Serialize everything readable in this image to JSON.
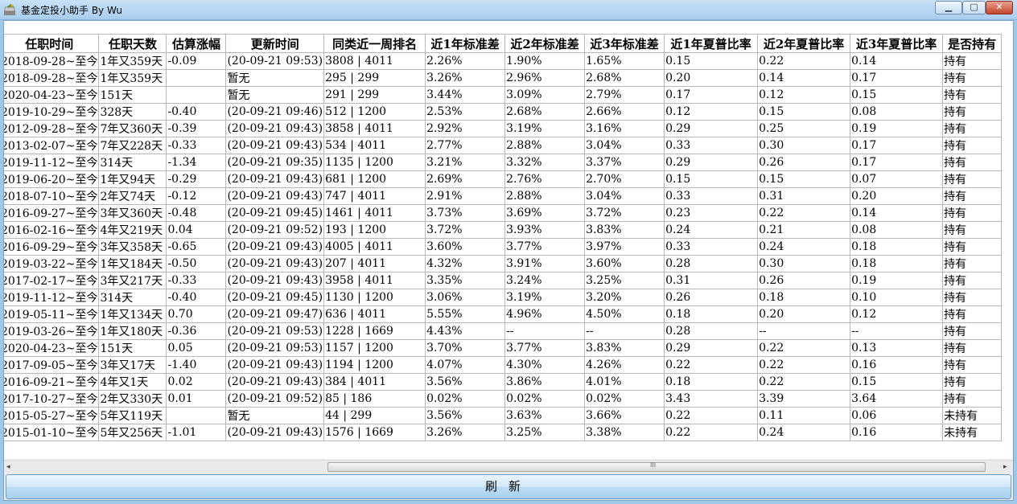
{
  "window": {
    "title": "基金定投小助手 By Wu",
    "min": "▁",
    "max": "▢",
    "close": "✕"
  },
  "table": {
    "columns": [
      "任职时间",
      "任职天数",
      "估算涨幅",
      "更新时间",
      "同类近一周排名",
      "近1年标准差",
      "近2年标准差",
      "近3年标准差",
      "近1年夏普比率",
      "近2年夏普比率",
      "近3年夏普比率",
      "是否持有"
    ],
    "rows": [
      [
        "2018-09-28~至今",
        "1年又359天",
        "-0.09",
        "(20-09-21 09:53)",
        "3808 | 4011",
        "2.26%",
        "1.90%",
        "1.65%",
        "0.15",
        "0.22",
        "0.14",
        "持有"
      ],
      [
        "2018-09-28~至今",
        "1年又359天",
        "",
        "暂无",
        "295 | 299",
        "3.26%",
        "2.96%",
        "2.68%",
        "0.20",
        "0.14",
        "0.17",
        "持有"
      ],
      [
        "2020-04-23~至今",
        "151天",
        "",
        "暂无",
        "291 | 299",
        "3.44%",
        "3.09%",
        "2.79%",
        "0.17",
        "0.12",
        "0.15",
        "持有"
      ],
      [
        "2019-10-29~至今",
        "328天",
        "-0.40",
        "(20-09-21 09:46)",
        "512 | 1200",
        "2.53%",
        "2.68%",
        "2.66%",
        "0.12",
        "0.15",
        "0.08",
        "持有"
      ],
      [
        "2012-09-28~至今",
        "7年又360天",
        "-0.39",
        "(20-09-21 09:43)",
        "3858 | 4011",
        "2.92%",
        "3.19%",
        "3.16%",
        "0.29",
        "0.25",
        "0.19",
        "持有"
      ],
      [
        "2013-02-07~至今",
        "7年又228天",
        "-0.33",
        "(20-09-21 09:43)",
        "534 | 4011",
        "2.77%",
        "2.88%",
        "3.04%",
        "0.33",
        "0.30",
        "0.17",
        "持有"
      ],
      [
        "2019-11-12~至今",
        "314天",
        "-1.34",
        "(20-09-21 09:35)",
        "1135 | 1200",
        "3.21%",
        "3.32%",
        "3.37%",
        "0.29",
        "0.26",
        "0.17",
        "持有"
      ],
      [
        "2019-06-20~至今",
        "1年又94天",
        "-0.29",
        "(20-09-21 09:43)",
        "681 | 1200",
        "2.69%",
        "2.76%",
        "2.70%",
        "0.15",
        "0.15",
        "0.07",
        "持有"
      ],
      [
        "2018-07-10~至今",
        "2年又74天",
        "-0.12",
        "(20-09-21 09:43)",
        "747 | 4011",
        "2.91%",
        "2.88%",
        "3.04%",
        "0.33",
        "0.31",
        "0.20",
        "持有"
      ],
      [
        "2016-09-27~至今",
        "3年又360天",
        "-0.48",
        "(20-09-21 09:45)",
        "1461 | 4011",
        "3.73%",
        "3.69%",
        "3.72%",
        "0.23",
        "0.22",
        "0.14",
        "持有"
      ],
      [
        "2016-02-16~至今",
        "4年又219天",
        "0.04",
        "(20-09-21 09:52)",
        "193 | 1200",
        "3.72%",
        "3.93%",
        "3.83%",
        "0.24",
        "0.21",
        "0.08",
        "持有"
      ],
      [
        "2016-09-29~至今",
        "3年又358天",
        "-0.65",
        "(20-09-21 09:43)",
        "4005 | 4011",
        "3.60%",
        "3.77%",
        "3.97%",
        "0.33",
        "0.24",
        "0.18",
        "持有"
      ],
      [
        "2019-03-22~至今",
        "1年又184天",
        "-0.50",
        "(20-09-21 09:43)",
        "207 | 4011",
        "4.32%",
        "3.91%",
        "3.60%",
        "0.28",
        "0.30",
        "0.18",
        "持有"
      ],
      [
        "2017-02-17~至今",
        "3年又217天",
        "-0.33",
        "(20-09-21 09:43)",
        "3958 | 4011",
        "3.35%",
        "3.24%",
        "3.25%",
        "0.31",
        "0.26",
        "0.19",
        "持有"
      ],
      [
        "2019-11-12~至今",
        "314天",
        "-0.40",
        "(20-09-21 09:45)",
        "1130 | 1200",
        "3.06%",
        "3.19%",
        "3.20%",
        "0.26",
        "0.18",
        "0.10",
        "持有"
      ],
      [
        "2019-05-11~至今",
        "1年又134天",
        "0.70",
        "(20-09-21 09:47)",
        "636 | 4011",
        "5.55%",
        "4.96%",
        "4.50%",
        "0.18",
        "0.20",
        "0.12",
        "持有"
      ],
      [
        "2019-03-26~至今",
        "1年又180天",
        "-0.36",
        "(20-09-21 09:53)",
        "1228 | 1669",
        "4.43%",
        "--",
        "--",
        "0.28",
        "--",
        "--",
        "持有"
      ],
      [
        "2020-04-23~至今",
        "151天",
        "0.05",
        "(20-09-21 09:53)",
        "1157 | 1200",
        "3.70%",
        "3.77%",
        "3.83%",
        "0.29",
        "0.22",
        "0.13",
        "持有"
      ],
      [
        "2017-09-05~至今",
        "3年又17天",
        "-1.40",
        "(20-09-21 09:43)",
        "1194 | 1200",
        "4.07%",
        "4.30%",
        "4.26%",
        "0.22",
        "0.22",
        "0.16",
        "持有"
      ],
      [
        "2016-09-21~至今",
        "4年又1天",
        "0.02",
        "(20-09-21 09:43)",
        "384 | 4011",
        "3.56%",
        "3.86%",
        "4.01%",
        "0.18",
        "0.22",
        "0.15",
        "持有"
      ],
      [
        "2017-10-27~至今",
        "2年又330天",
        "0.01",
        "(20-09-21 09:52)",
        "85 | 186",
        "0.02%",
        "0.02%",
        "0.02%",
        "3.43",
        "3.39",
        "3.64",
        "持有"
      ],
      [
        "2015-05-27~至今",
        "5年又119天",
        "",
        "暂无",
        "44 | 299",
        "3.56%",
        "3.63%",
        "3.66%",
        "0.22",
        "0.11",
        "0.06",
        "未持有"
      ],
      [
        "2015-01-10~至今",
        "5年又256天",
        "-1.01",
        "(20-09-21 09:43)",
        "1576 | 1669",
        "3.26%",
        "3.25%",
        "3.38%",
        "0.22",
        "0.24",
        "0.16",
        "未持有"
      ]
    ]
  },
  "scrollbar": {
    "left": "◂",
    "right": "▸",
    "grip": "III"
  },
  "refresh_label": "刷新",
  "colors": {
    "positive_change": "#e00000",
    "title_bar": "#b9d7f1",
    "button": "#c4e1f7"
  }
}
